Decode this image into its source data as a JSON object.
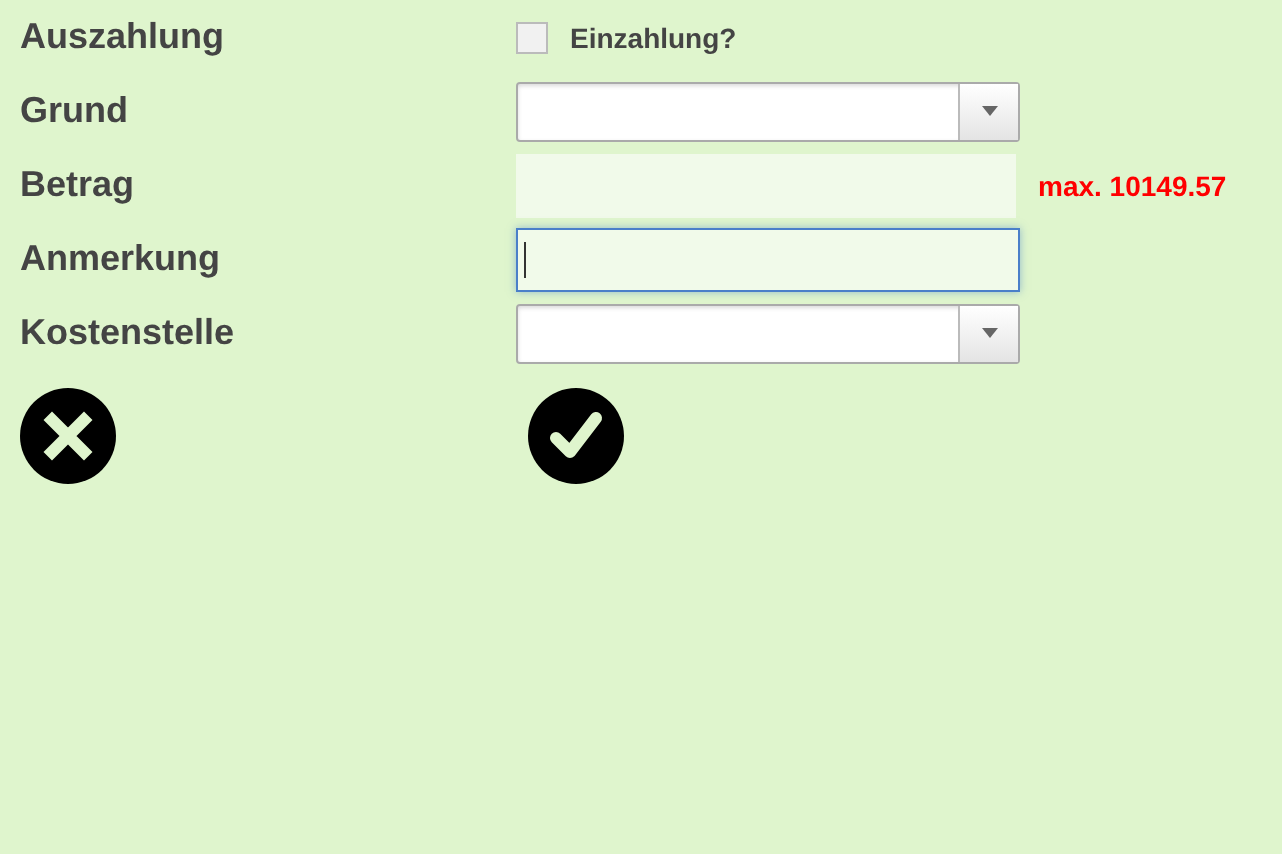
{
  "form": {
    "rows": [
      {
        "label": "Auszahlung",
        "kind": "checkbox",
        "checkbox_label": "Einzahlung?",
        "checked": false
      },
      {
        "label": "Grund",
        "kind": "select"
      },
      {
        "label": "Betrag",
        "kind": "input",
        "focused": false,
        "hint": "max. 10149.57"
      },
      {
        "label": "Anmerkung",
        "kind": "input",
        "focused": true
      },
      {
        "label": "Kostenstelle",
        "kind": "select"
      }
    ]
  }
}
